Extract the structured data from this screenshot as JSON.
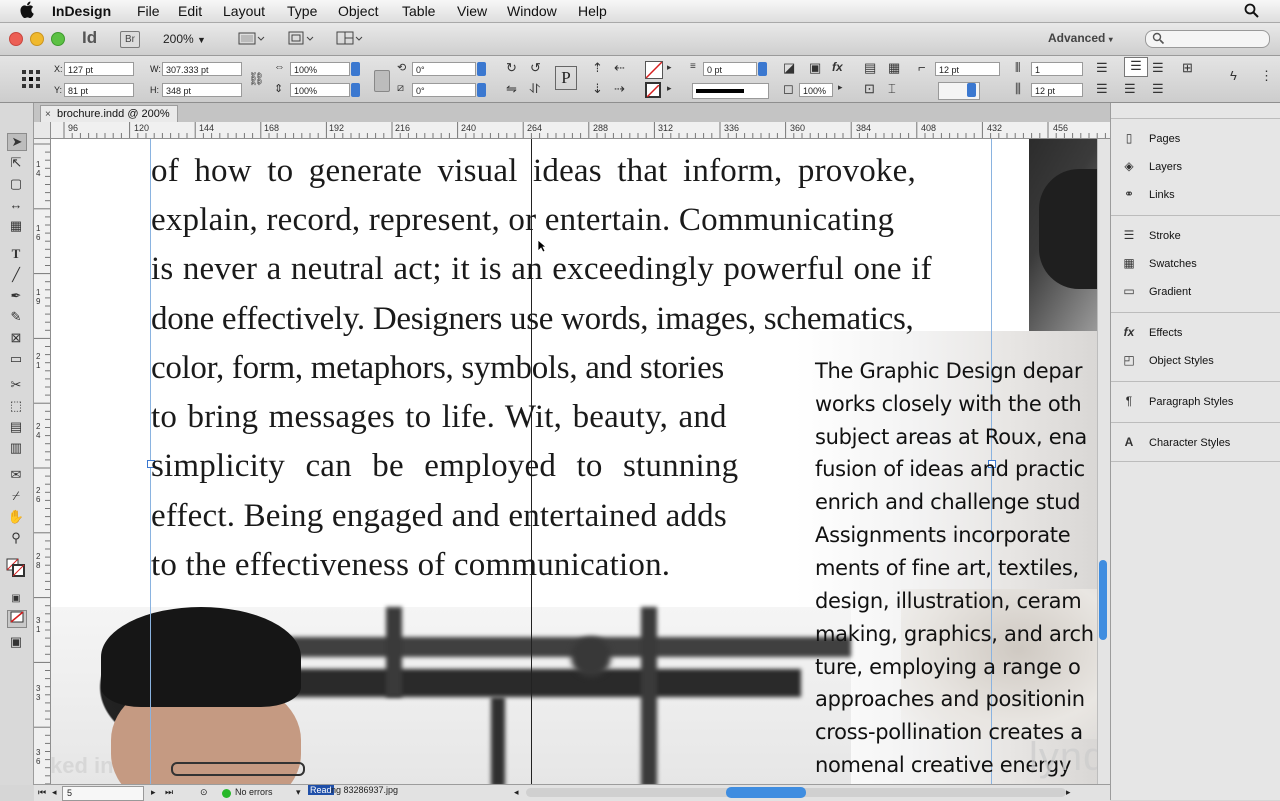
{
  "menubar": {
    "app": "InDesign",
    "items": [
      "File",
      "Edit",
      "Layout",
      "Type",
      "Object",
      "Table",
      "View",
      "Window",
      "Help"
    ]
  },
  "appbar": {
    "logo": "Id",
    "bridge": "Br",
    "zoom": "200%",
    "workspace": "Advanced"
  },
  "control": {
    "x_label": "X:",
    "x_value": "127 pt",
    "y_label": "Y:",
    "y_value": "81 pt",
    "w_label": "W:",
    "w_value": "307.333 pt",
    "h_label": "H:",
    "h_value": "348 pt",
    "scale_x": "100%",
    "scale_y": "100%",
    "rotate": "0°",
    "shear": "0°",
    "stroke_weight": "0 pt",
    "opacity": "100%",
    "columns": "1",
    "gutter": "12 pt",
    "inset": "12 pt",
    "p_icon": "P"
  },
  "document": {
    "tab_title": "brochure.indd @ 200%"
  },
  "ruler": {
    "h_ticks": [
      "96",
      "120",
      "144",
      "168",
      "192",
      "216",
      "240",
      "264",
      "288",
      "312",
      "336",
      "360",
      "384",
      "408",
      "432",
      "456"
    ],
    "v_ticks": [
      "1 4",
      "1 6",
      "1 9",
      "2 1",
      "2 4",
      "2 6",
      "2 8",
      "3 1",
      "3 3",
      "3 6"
    ]
  },
  "body_text": {
    "lines": [
      "of how to generate visual ideas that inform, provoke,",
      "explain, record, represent, or entertain. Communicating",
      "is never a neutral act; it is an exceedingly powerful one if",
      "done effectively. Designers use words, images, schematics,",
      "color, form, metaphors, symbols, and stories",
      "to bring messages to life. Wit, beauty, and",
      "simplicity can be employed to stunning",
      "effect. Being engaged and entertained adds",
      "to the effectiveness of communication."
    ]
  },
  "side_text": {
    "lines": [
      "The Graphic Design depar",
      "works closely with the oth",
      "subject areas at Roux, ena",
      "fusion of ideas and practic",
      "enrich and challenge stud",
      "Assignments incorporate",
      "ments of fine art, textiles,",
      "design, illustration, ceram",
      "making, graphics, and arch",
      "ture, employing a range o",
      "approaches and positionin",
      "cross-pollination creates a",
      "nomenal creative energy"
    ]
  },
  "status": {
    "page": "5",
    "errors": "No errors",
    "reading": "Read",
    "file": "ng 83286937.jpg"
  },
  "panels": {
    "items": [
      "Pages",
      "Layers",
      "Links",
      "Stroke",
      "Swatches",
      "Gradient",
      "Effects",
      "Object Styles",
      "Paragraph Styles",
      "Character Styles"
    ]
  },
  "watermark": {
    "linkedin": "Linked in",
    "lynda": "lynda.com"
  },
  "colors": {
    "accent_blue": "#3b78d0",
    "status_green": "#27b829",
    "traffic_red": "#ec5f55",
    "traffic_yellow": "#f0b92d",
    "traffic_green": "#5cc144"
  }
}
